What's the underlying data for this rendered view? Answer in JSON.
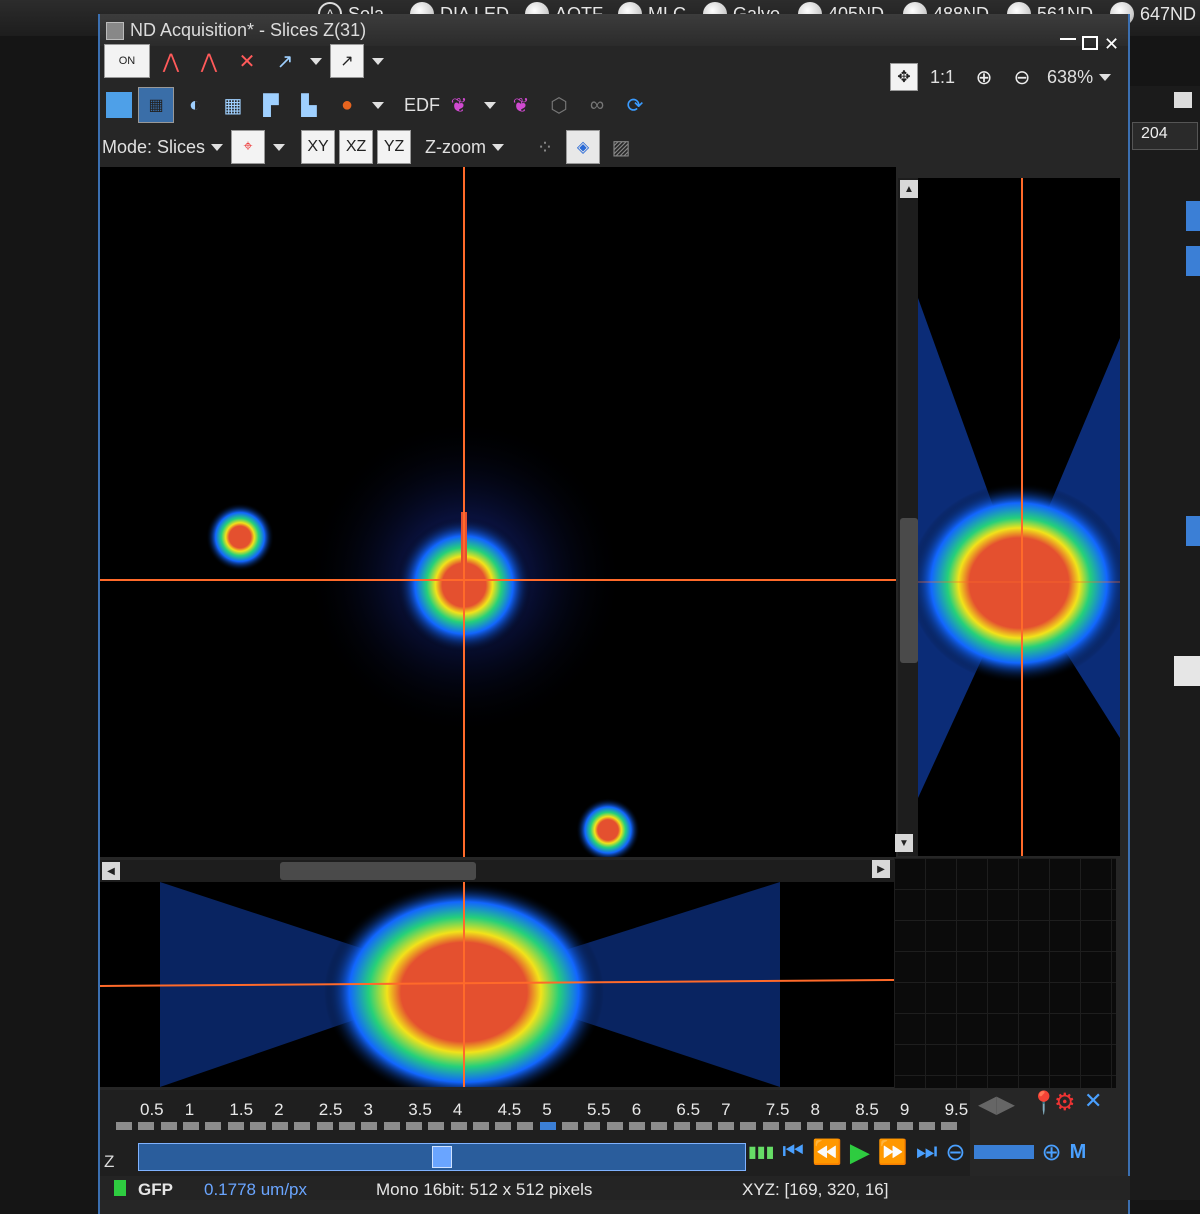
{
  "top_bar": {
    "items": [
      {
        "label": "Sola",
        "kind": "active"
      },
      {
        "label": "DIA LED"
      },
      {
        "label": "AOTF"
      },
      {
        "label": "MLC"
      },
      {
        "label": "Galvo"
      },
      {
        "label": "405ND"
      },
      {
        "label": "488ND"
      },
      {
        "label": "561ND"
      },
      {
        "label": "647ND"
      }
    ]
  },
  "window": {
    "title": "ND Acquisition* - Slices  Z(31)"
  },
  "toolbar1": {
    "zoom_1to1": "1:1",
    "zoom_value": "638%"
  },
  "toolbar2": {
    "edf_label": "EDF"
  },
  "toolbar3": {
    "mode_label": "Mode: Slices",
    "xy": "XY",
    "xz": "XZ",
    "yz": "YZ",
    "zzoom": "Z-zoom"
  },
  "right_panel": {
    "zoom_value": "204"
  },
  "z_slider": {
    "axis_label": "Z",
    "ticks": [
      "0.5",
      "1",
      "1.5",
      "2",
      "2.5",
      "3",
      "3.5",
      "4",
      "4.5",
      "5",
      "5.5",
      "6",
      "6.5",
      "7",
      "7.5",
      "8",
      "8.5",
      "9",
      "9.5"
    ],
    "position_fraction": 0.5
  },
  "status": {
    "channel": "GFP",
    "pixel_size": "0.1778 um/px",
    "format": "Mono 16bit: 512 x 512 pixels",
    "cursor": "XYZ: [169, 320, 16]"
  },
  "colors": {
    "crosshair": "#ff6a2a",
    "hot": "#e4502f",
    "window_border": "#3b6fb0"
  }
}
